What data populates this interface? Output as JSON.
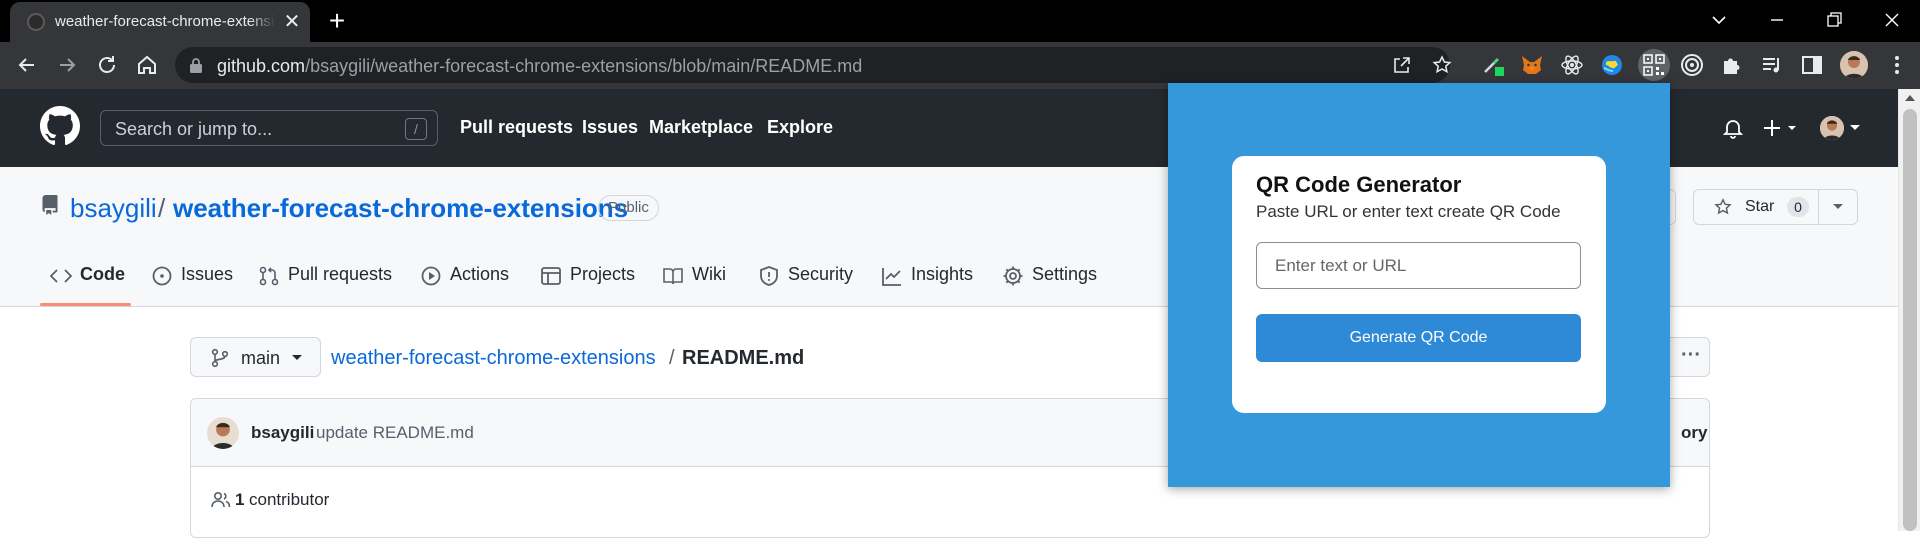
{
  "browser": {
    "tab_title": "weather-forecast-chrome-extensions/README.md",
    "tab_close_glyph": "✕",
    "new_tab_glyph": "+",
    "url_host": "github.com",
    "url_path": "/bsaygili/weather-forecast-chrome-extensions/blob/main/README.md",
    "extensions": [
      "eyedropper-extension-icon",
      "metamask-fox-icon",
      "react-devtools-icon",
      "globe-extension-icon",
      "qr-code-extension-icon",
      "target-extension-icon",
      "puzzle-extensions-icon"
    ],
    "colors": {
      "tabstrip": "#000000",
      "toolbar": "#35363a",
      "omnibox": "#202124"
    }
  },
  "gh_header": {
    "search_placeholder": "Search or jump to...",
    "search_shortcut": "/",
    "nav": [
      "Pull requests",
      "Issues",
      "Marketplace",
      "Explore"
    ]
  },
  "repo": {
    "owner": "bsaygili",
    "separator": "/",
    "name": "weather-forecast-chrome-extensions",
    "visibility": "Public",
    "tabs": [
      "Code",
      "Issues",
      "Pull requests",
      "Actions",
      "Projects",
      "Wiki",
      "Security",
      "Insights",
      "Settings"
    ],
    "active_tab": "Code",
    "star_label": "Star",
    "star_count": "0"
  },
  "file": {
    "branch": "main",
    "crumb_repo": "weather-forecast-chrome-extensions",
    "crumb_sep": "/",
    "crumb_file": "README.md",
    "more_glyph": "···"
  },
  "commit": {
    "author": "bsaygili",
    "message": "update README.md",
    "history_label": "ory",
    "contributor_count": "1",
    "contributor_label": "contributor"
  },
  "popup": {
    "title": "QR Code Generator",
    "subtitle": "Paste URL or enter text create QR Code",
    "input_placeholder": "Enter text or URL",
    "input_value": "",
    "button_label": "Generate QR Code",
    "colors": {
      "background": "#3498db",
      "button": "#2e8ad6"
    }
  }
}
